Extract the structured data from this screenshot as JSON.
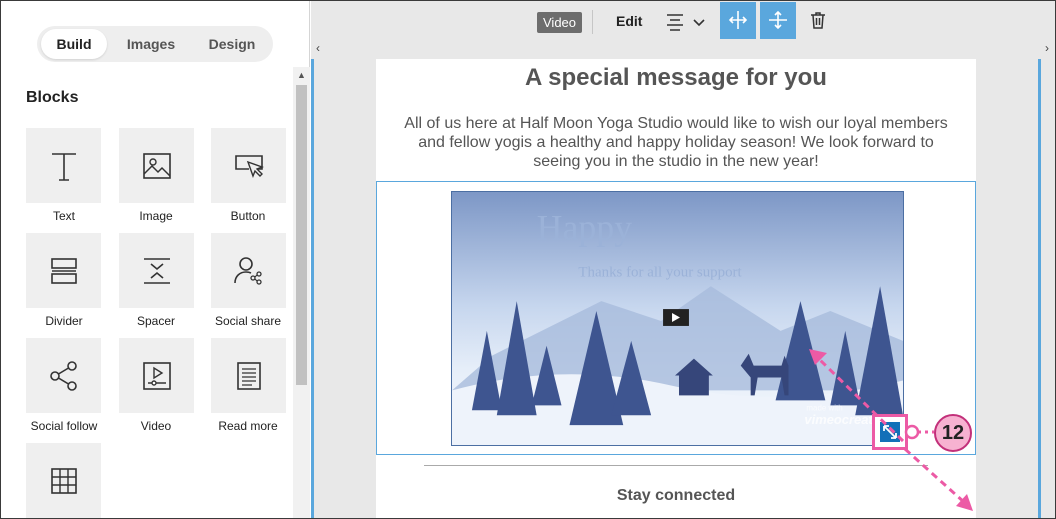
{
  "left_panel": {
    "tabs": [
      {
        "label": "Build",
        "active": true
      },
      {
        "label": "Images",
        "active": false
      },
      {
        "label": "Design",
        "active": false
      }
    ],
    "blocks_title": "Blocks",
    "blocks": [
      {
        "label": "Text",
        "icon": "text-icon"
      },
      {
        "label": "Image",
        "icon": "image-icon"
      },
      {
        "label": "Button",
        "icon": "button-icon"
      },
      {
        "label": "Divider",
        "icon": "divider-icon"
      },
      {
        "label": "Spacer",
        "icon": "spacer-icon"
      },
      {
        "label": "Social share",
        "icon": "social-share-icon"
      },
      {
        "label": "Social follow",
        "icon": "social-follow-icon"
      },
      {
        "label": "Video",
        "icon": "video-icon"
      },
      {
        "label": "Read more",
        "icon": "read-more-icon"
      },
      {
        "label": "",
        "icon": "table-icon"
      }
    ]
  },
  "toolbar": {
    "element_badge": "Video",
    "edit_label": "Edit",
    "icons": [
      "align-icon",
      "chevron-down-icon",
      "fit-width-icon",
      "fit-height-icon",
      "trash-icon"
    ],
    "accent_color": "#5aa7dd"
  },
  "email": {
    "title": "A special message for you",
    "body": "All of us here at Half Moon Yoga Studio would like to wish our loyal members and fellow yogis a healthy and happy holiday season! We look forward to seeing you in the studio in the new year!",
    "video": {
      "headline": "Happy",
      "subline": "Thanks for all your support",
      "watermark_made": "made with",
      "watermark_brand": "vimeocreate"
    },
    "footer_heading": "Stay connected"
  },
  "annotation": {
    "step_number": "12",
    "color": "#ec5aa5"
  }
}
